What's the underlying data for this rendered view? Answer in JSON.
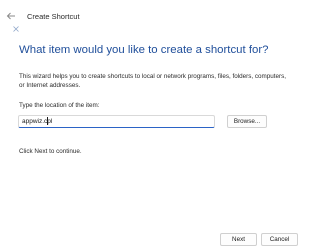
{
  "window": {
    "title": "Create Shortcut",
    "back_icon": "back-arrow-icon",
    "app_icon": "shortcut-wizard-icon"
  },
  "main": {
    "heading": "What item would you like to create a shortcut for?",
    "description": "This wizard helps you to create shortcuts to local or network programs, files, folders, computers, or Internet addresses.",
    "location_label": "Type the location of the item:",
    "location_value": "appwiz.cpl",
    "browse_label": "Browse...",
    "hint": "Click Next to continue."
  },
  "footer": {
    "next_label": "Next",
    "cancel_label": "Cancel"
  },
  "colors": {
    "heading": "#1f4e9a",
    "accent": "#2b63c6"
  }
}
